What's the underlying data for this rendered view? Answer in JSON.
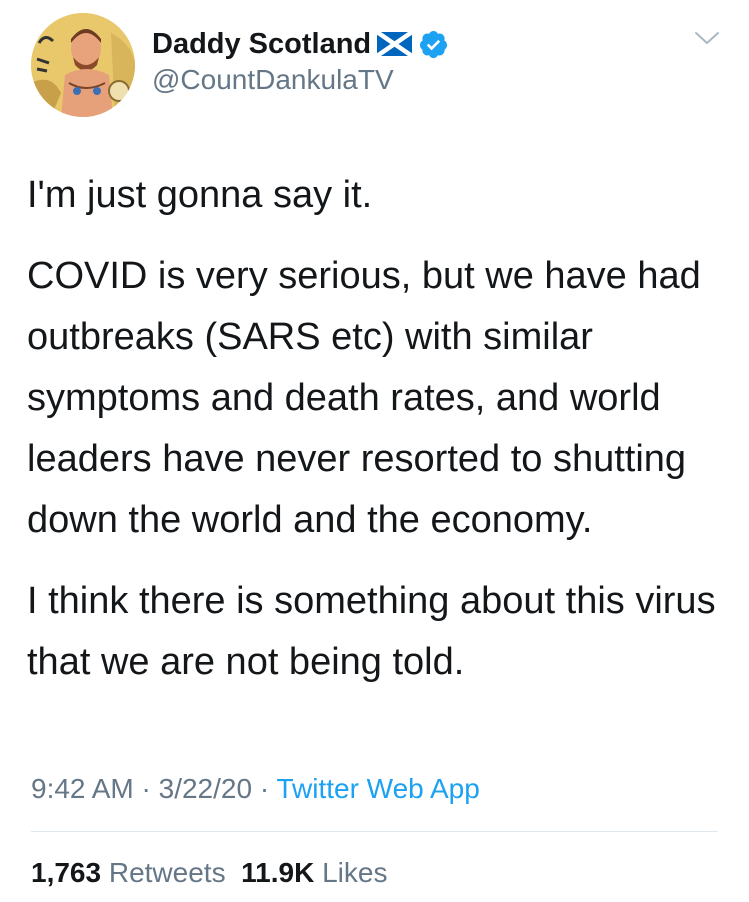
{
  "tweet": {
    "display_name": "Daddy Scotland",
    "handle": "@CountDankulaTV",
    "flag_icon": "scotland-flag-icon",
    "verified_icon": "verified-badge-icon",
    "paragraphs": [
      "I'm just gonna say it.",
      "COVID is very serious, but we have had outbreaks (SARS etc) with similar symptoms and death rates, and world leaders have never resorted to shutting down the world and the economy.",
      "I think there is something about this virus that we are not being told."
    ],
    "time": "9:42 AM",
    "date": "3/22/20",
    "source": "Twitter Web App",
    "sep": "·"
  },
  "stats": {
    "retweets_count": "1,763",
    "retweets_label": "Retweets",
    "likes_count": "11.9K",
    "likes_label": "Likes"
  },
  "colors": {
    "text": "#14171a",
    "secondary": "#657786",
    "link": "#1da1f2",
    "verified": "#1da1f2",
    "divider": "#e1e8ed"
  }
}
